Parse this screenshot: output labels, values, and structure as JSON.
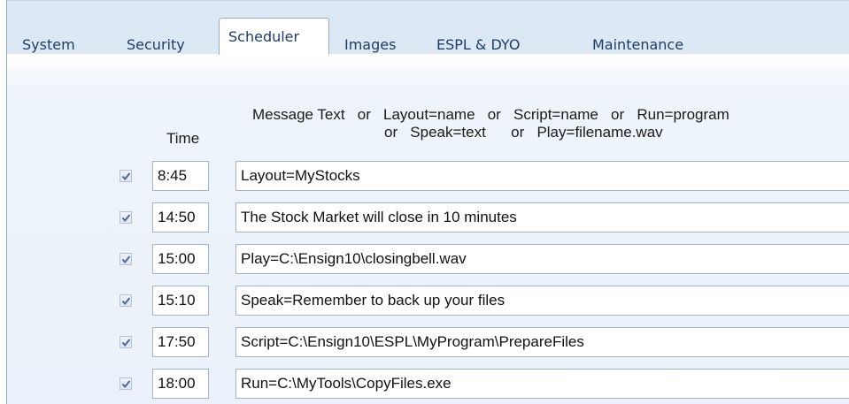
{
  "tabs": [
    {
      "label": "System",
      "active": false
    },
    {
      "label": "Security",
      "active": false
    },
    {
      "label": "Scheduler",
      "active": true
    },
    {
      "label": "Images",
      "active": false
    },
    {
      "label": "ESPL & DYO",
      "active": false
    },
    {
      "label": "Maintenance",
      "active": false
    }
  ],
  "header": {
    "time_label": "Time",
    "message_line1": "Message Text   or   Layout=name   or   Script=name   or   Run=program",
    "message_line2": "or   Speak=text      or   Play=filename.wav"
  },
  "schedule": [
    {
      "checked": true,
      "time": "8:45",
      "message": "Layout=MyStocks"
    },
    {
      "checked": true,
      "time": "14:50",
      "message": "The Stock Market will close in 10 minutes"
    },
    {
      "checked": true,
      "time": "15:00",
      "message": "Play=C:\\Ensign10\\closingbell.wav"
    },
    {
      "checked": true,
      "time": "15:10",
      "message": "Speak=Remember to back up your files"
    },
    {
      "checked": true,
      "time": "17:50",
      "message": "Script=C:\\Ensign10\\ESPL\\MyProgram\\PrepareFiles"
    },
    {
      "checked": true,
      "time": "18:00",
      "message": "Run=C:\\MyTools\\CopyFiles.exe"
    }
  ],
  "icons": {
    "checkbox": "checkmark-icon"
  },
  "colors": {
    "tab_text": "#1f3d66",
    "tab_strip": "#dde8f5",
    "panel": "#eaf1fa",
    "check": "#4a6a93"
  }
}
